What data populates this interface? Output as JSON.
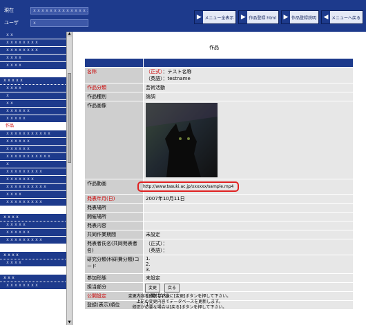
{
  "header": {
    "field1_label": "現在",
    "field1_value": "ｘｘｘｘｘｘｘｘｘｘｘｘｘｘ",
    "field2_label": "ユーザ",
    "field2_value": "ｘ",
    "buttons": [
      {
        "label": "メニュー全表示"
      },
      {
        "label": "作品登録 html"
      },
      {
        "label": "作品登録説明"
      },
      {
        "label": "メニューへ戻る"
      }
    ]
  },
  "sidebar": {
    "groups": [
      {
        "head": "",
        "items": [
          "ｘｘ",
          "ｘｘｘｘｘｘｘｘ",
          "ｘｘｘｘｘｘｘｘ",
          "ｘｘｘｘ",
          "ｘｘｘｘ"
        ]
      },
      {
        "head": "ｘｘｘｘｘ",
        "items": [
          "ｘｘｘｘ",
          "ｘ",
          "ｘｘ",
          "ｘｘｘｘｘｘ",
          "ｘｘｘｘｘ",
          "作品",
          "ｘｘｘｘｘｘｘｘｘｘｘ",
          "ｘｘｘｘｘｘ",
          "ｘｘｘｘｘｘ",
          "ｘｘｘｘｘｘｘｘｘｘｘ",
          "ｘ",
          "ｘｘｘｘｘｘｘｘｘ",
          "ｘｘｘｘｘｘｘ",
          "ｘｘｘｘｘｘｘｘｘｘ",
          "ｘｘｘｘ",
          "ｘｘｘｘｘｘｘｘｘ"
        ]
      },
      {
        "head": "ｘｘｘｘ",
        "items": [
          "ｘｘｘｘｘ",
          "ｘｘｘｘｘｘ",
          "ｘｘｘｘｘｘｘｘｘ"
        ]
      },
      {
        "head": "ｘｘｘｘ",
        "items": [
          "ｘｘｘｘ"
        ]
      },
      {
        "head": "ｘｘｘ",
        "items": [
          "ｘｘｘｘｘｘｘｘ"
        ]
      }
    ],
    "active_item": "作品"
  },
  "main": {
    "title": "作品",
    "col_headers": [
      "",
      ""
    ],
    "rows": {
      "name": {
        "label": "名称",
        "v1_tag": "（正式）",
        "v1": "テスト名称",
        "v2_tag": "（英語）",
        "v2": "testname"
      },
      "category": {
        "label": "作品分類",
        "value": "芸術活動"
      },
      "kind": {
        "label": "作品種別",
        "value": "論調"
      },
      "image": {
        "label": "作品画像"
      },
      "movie": {
        "label": "作品動画",
        "value": "http://www.tasuki.ac.jp/xxxxxx/sample.mp4"
      },
      "published": {
        "label": "発表年月(日)",
        "value": "2007年10月11日"
      },
      "place": {
        "label": "発表場所",
        "value": ""
      },
      "venue": {
        "label": "開催場所",
        "value": ""
      },
      "content": {
        "label": "発表内容",
        "value": ""
      },
      "joint": {
        "label": "共同作業期間",
        "value": "未設定"
      },
      "coauthors": {
        "label": "発表者氏名(共同発表者名)",
        "v1": "（正式）：",
        "v2": "（英語）："
      },
      "research": {
        "label": "研究分類(科研費分類)コード",
        "lines": [
          "1.",
          "2.",
          "3."
        ]
      },
      "participation": {
        "label": "参加形態",
        "value": "未設定"
      },
      "role": {
        "label": "担当部分",
        "value": ""
      },
      "publish": {
        "label": "公開設定",
        "value": "公開(学内)"
      },
      "order": {
        "label": "登録(表示)順位",
        "value": "1"
      }
    },
    "buttons": {
      "change": "変更",
      "back": "戻る"
    },
    "notes": [
      "変更内容を修正した後に[変更]ボタンを押して下さい。",
      "上記の変更内容でデータベースを更新します。",
      "修正が必要な場合は[戻る]ボタンを押して下さい。"
    ]
  },
  "colors": {
    "accent": "#1d3a8c",
    "required": "#cc0000",
    "highlight": "#e02020"
  }
}
